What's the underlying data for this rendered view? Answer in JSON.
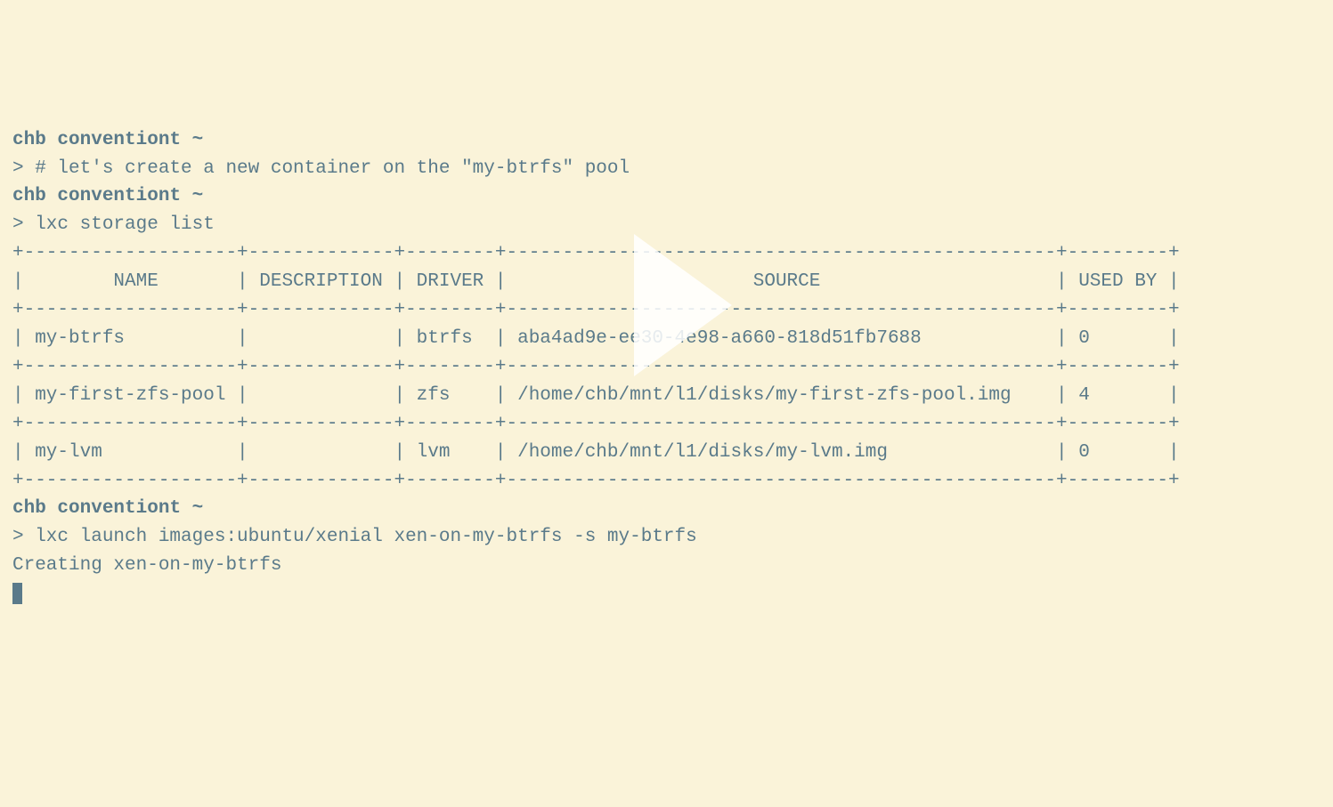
{
  "p1": {
    "user": "chb",
    "host": "conventiont",
    "path": "~"
  },
  "c1": "> # let's create a new container on the \"my-btrfs\" pool",
  "p2": {
    "user": "chb",
    "host": "conventiont",
    "path": "~"
  },
  "c2": "> lxc storage list",
  "t": {
    "border1": "+-------------------+-------------+--------+-------------------------------------------------+---------+",
    "header": "|        NAME       | DESCRIPTION | DRIVER |                      SOURCE                     | USED BY |",
    "border2": "+-------------------+-------------+--------+-------------------------------------------------+---------+",
    "row1": "| my-btrfs          |             | btrfs  | aba4ad9e-ee30-4e98-a660-818d51fb7688            | 0       |",
    "border3": "+-------------------+-------------+--------+-------------------------------------------------+---------+",
    "row2": "| my-first-zfs-pool |             | zfs    | /home/chb/mnt/l1/disks/my-first-zfs-pool.img    | 4       |",
    "border4": "+-------------------+-------------+--------+-------------------------------------------------+---------+",
    "row3": "| my-lvm            |             | lvm    | /home/chb/mnt/l1/disks/my-lvm.img               | 0       |",
    "border5": "+-------------------+-------------+--------+-------------------------------------------------+---------+"
  },
  "p3": {
    "user": "chb",
    "host": "conventiont",
    "path": "~"
  },
  "c3": "> lxc launch images:ubuntu/xenial xen-on-my-btrfs -s my-btrfs",
  "out1": "Creating xen-on-my-btrfs",
  "chart_data": {
    "type": "table",
    "title": "lxc storage list",
    "columns": [
      "NAME",
      "DESCRIPTION",
      "DRIVER",
      "SOURCE",
      "USED BY"
    ],
    "rows": [
      {
        "NAME": "my-btrfs",
        "DESCRIPTION": "",
        "DRIVER": "btrfs",
        "SOURCE": "aba4ad9e-ee30-4e98-a660-818d51fb7688",
        "USED BY": 0
      },
      {
        "NAME": "my-first-zfs-pool",
        "DESCRIPTION": "",
        "DRIVER": "zfs",
        "SOURCE": "/home/chb/mnt/l1/disks/my-first-zfs-pool.img",
        "USED BY": 4
      },
      {
        "NAME": "my-lvm",
        "DESCRIPTION": "",
        "DRIVER": "lvm",
        "SOURCE": "/home/chb/mnt/l1/disks/my-lvm.img",
        "USED BY": 0
      }
    ]
  }
}
